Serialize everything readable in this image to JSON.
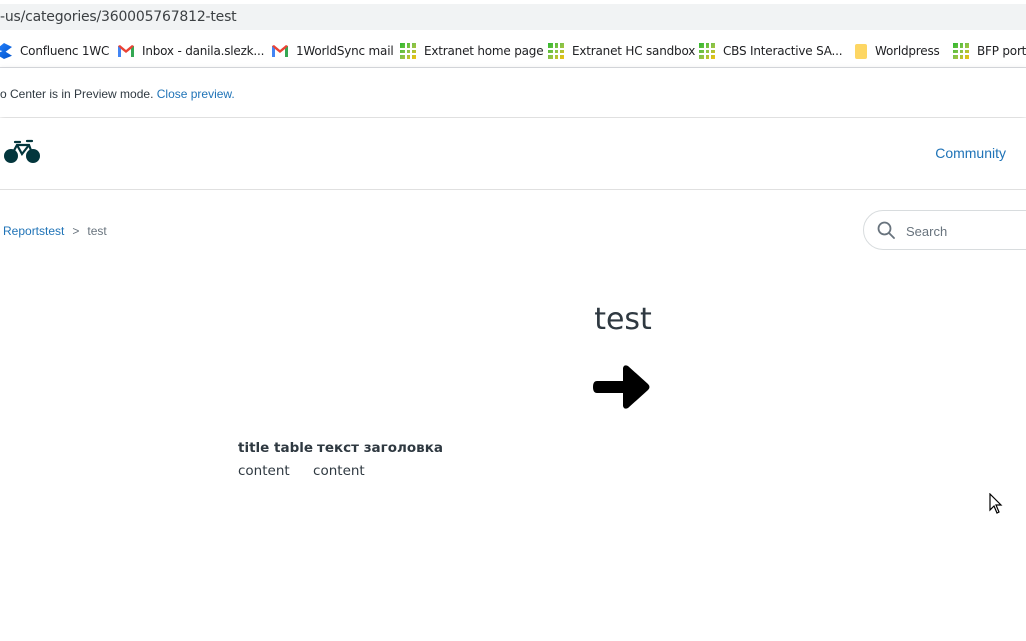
{
  "browser": {
    "url": "-us/categories/360005767812-test",
    "bookmarks": [
      {
        "label": "Confluenc 1WC",
        "icon": "confluence-icon"
      },
      {
        "label": "Inbox - danila.slezk...",
        "icon": "gmail-icon"
      },
      {
        "label": "1WorldSync mail",
        "icon": "gmail-icon"
      },
      {
        "label": "Extranet home page",
        "icon": "grid-icon"
      },
      {
        "label": "Extranet HC sandbox",
        "icon": "grid-icon"
      },
      {
        "label": "CBS Interactive SA...",
        "icon": "grid-icon"
      },
      {
        "label": "Worldpress",
        "icon": "folder-icon"
      },
      {
        "label": "BFP porta",
        "icon": "grid-icon"
      }
    ]
  },
  "preview_banner": {
    "text": "o Center is in Preview mode. ",
    "link": "Close preview."
  },
  "header": {
    "logo_icon": "bicycle-icon",
    "nav_community": "Community"
  },
  "breadcrumb": {
    "items": [
      "Reportstest",
      ">",
      "test"
    ]
  },
  "search": {
    "placeholder": "Search"
  },
  "main": {
    "title": "test",
    "arrow_icon": "arrow-right-icon",
    "table": {
      "headers": [
        "title table",
        "текст заголовка"
      ],
      "rows": [
        [
          "content",
          "content"
        ]
      ]
    }
  },
  "colors": {
    "link": "#1f73b7",
    "text": "#2f3941",
    "logo": "#03363d"
  }
}
